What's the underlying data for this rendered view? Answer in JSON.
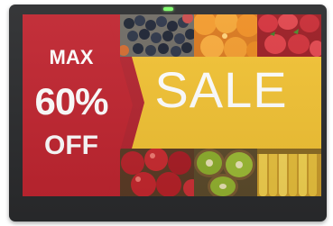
{
  "sign": {
    "max": "MAX",
    "percent": "60%",
    "off": "OFF",
    "sale": "SALE"
  },
  "colors": {
    "red_panel": "#c0242f",
    "banner": "#f2c233",
    "frame": "#2a2b2d",
    "led": "#7cff6a"
  },
  "photos": {
    "top_left": "blueberries-image",
    "top_middle": "oranges-image",
    "top_right": "strawberries-image",
    "bottom_left": "apples-image",
    "bottom_middle": "kiwis-image",
    "bottom_right": "bananas-image"
  }
}
